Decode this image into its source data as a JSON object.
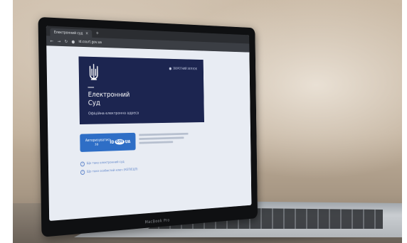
{
  "browser": {
    "tab_title": "Електронний суд",
    "tab_close_glyph": "×",
    "new_tab_glyph": "+",
    "url": "id.court.gov.ua",
    "nav_icons": [
      "back-icon",
      "forward-icon",
      "reload-icon",
      "lock-icon"
    ]
  },
  "hero": {
    "emblem_icon": "trident-icon",
    "top_link": "ЗВОРОТНИЙ ЗВ'ЯЗОК",
    "title_line1": "Електронний",
    "title_line2": "Суд",
    "subtitle": "Офіційна електронна адреса",
    "background_color": "#1c2550"
  },
  "auth": {
    "button_label": "Авторизуватись за",
    "id_part1": "ID",
    "id_part2": "GOV",
    "id_part3": "UA",
    "button_color": "#2e6ec6"
  },
  "info_links": [
    {
      "icon": "question-icon",
      "label": "Що таке електронний суд"
    },
    {
      "icon": "question-icon",
      "label": "Що таке особистий ключ (КЕП/ЕЦП)"
    }
  ],
  "device": {
    "brand": "MacBook Pro"
  }
}
